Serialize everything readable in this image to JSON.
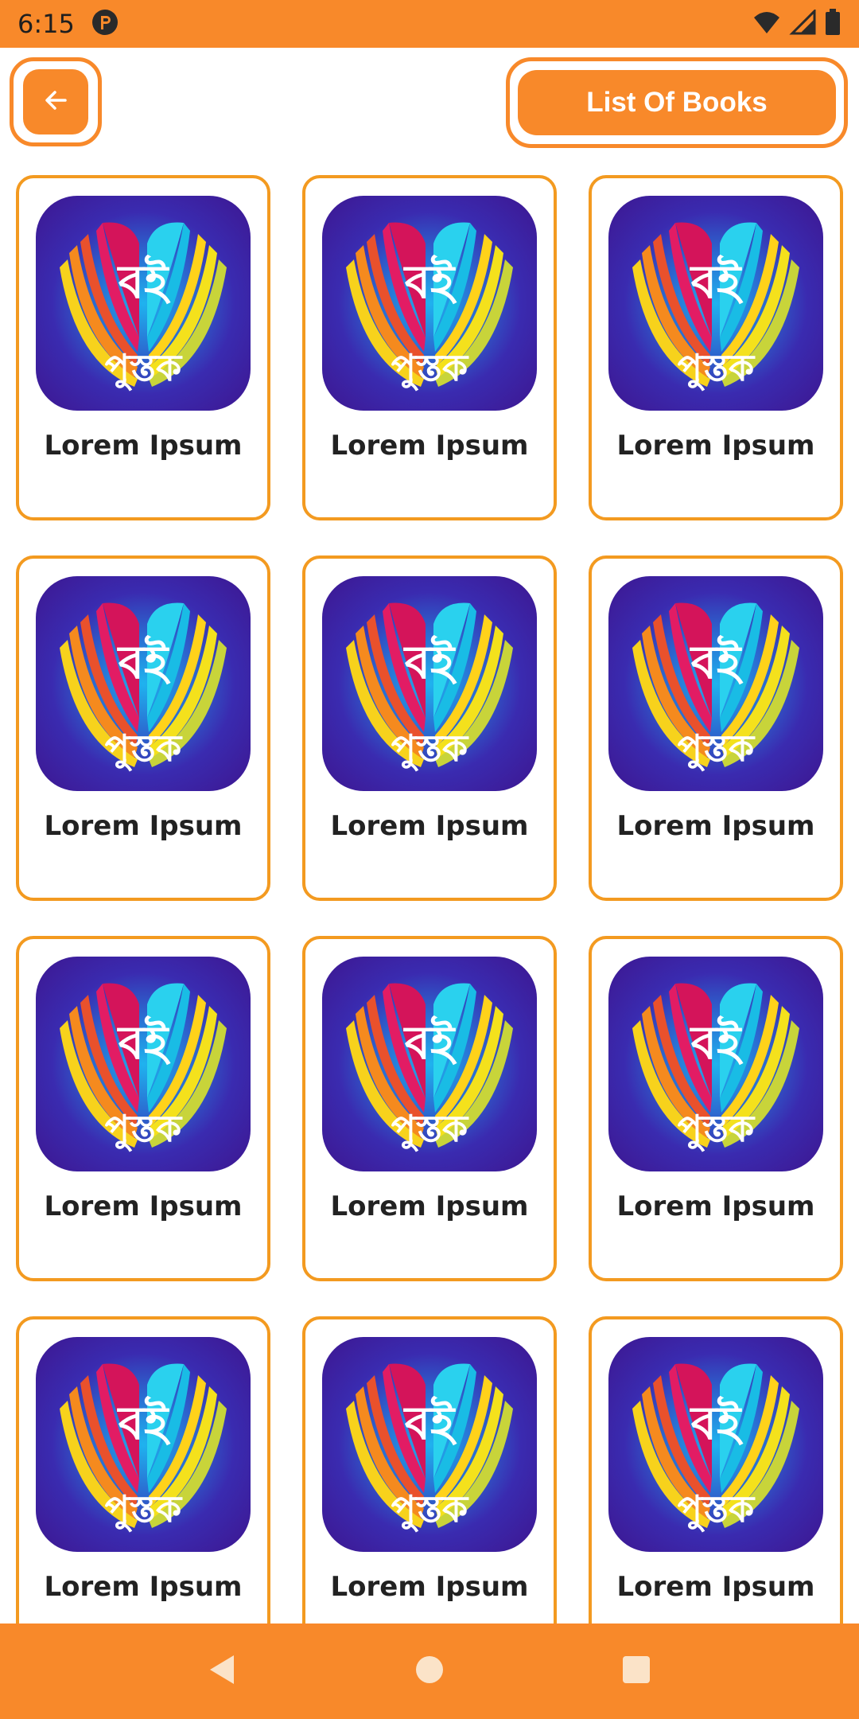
{
  "status_bar": {
    "time": "6:15",
    "icons": [
      "app-notification-icon",
      "wifi-icon",
      "signal-icon",
      "battery-icon"
    ]
  },
  "header": {
    "back_icon": "arrow-left-icon",
    "title": "List Of Books"
  },
  "books": [
    {
      "label": "Lorem Ipsum"
    },
    {
      "label": "Lorem Ipsum"
    },
    {
      "label": "Lorem Ipsum"
    },
    {
      "label": "Lorem Ipsum"
    },
    {
      "label": "Lorem Ipsum"
    },
    {
      "label": "Lorem Ipsum"
    },
    {
      "label": "Lorem Ipsum"
    },
    {
      "label": "Lorem Ipsum"
    },
    {
      "label": "Lorem Ipsum"
    },
    {
      "label": "Lorem Ipsum"
    },
    {
      "label": "Lorem Ipsum"
    },
    {
      "label": "Lorem Ipsum"
    }
  ],
  "book_icon": {
    "logo_text_top": "বই",
    "logo_text_bottom": "পুস্তক"
  },
  "nav_bar": {
    "buttons": [
      "back-triangle-icon",
      "home-circle-icon",
      "recents-square-icon"
    ]
  },
  "colors": {
    "accent": "#f8892a",
    "card_border": "#f39a20"
  }
}
